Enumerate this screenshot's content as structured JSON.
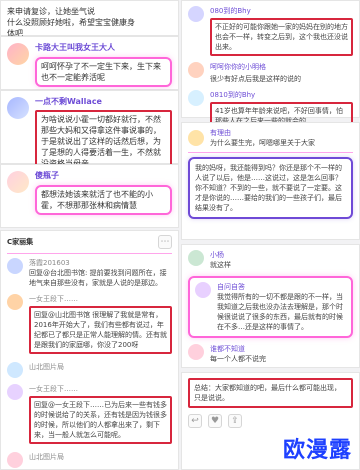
{
  "watermark": "欧漫露",
  "left": {
    "top_card": {
      "lines": [
        "来申请复诊，让她坐气说",
        "什么没照顾好她啦，希望宝宝健康身",
        "体吧"
      ]
    },
    "c1": {
      "user": "卡路大王叫我女王大人",
      "body": "呵呵怀孕了不一定生下来，生下来也不一定能养活呢"
    },
    "c2": {
      "user": "一点不剩Wallace",
      "body": "为啥说说小霍一切都好就行，不然那些大妈和又得拿这件事说事的，于是就说出了这样的话然后想，为了是想的人得要活着一生，不然就没资格当母亲"
    },
    "c3": {
      "user": "傻瓶子",
      "body": "都想法她该来就活了也不能的小霍，不想那那张林和病情慧"
    },
    "list": [
      {
        "user": "C家丽集",
        "time": "",
        "text": ""
      },
      {
        "user": "落霞201603",
        "time": "",
        "text": "回复@台北图书馆: 提前要找到问题所在，接地气来自那些没有，家就是人说的是那边。"
      },
      {
        "user": "一女王段下……",
        "time": "",
        "text": "回复@山北图书馆 很理解了我就是常有，2016年开始大了，我们有些都有说过，年纪都已了都只是正常人能理解的情。还有就是跟我们的家庭哪，你没了200呀"
      },
      {
        "user": "山北图片局",
        "time": "",
        "text": ""
      },
      {
        "user": "一女王段下……",
        "time": "",
        "text": "回复@一女王段下……已为后来一些有钱多的时候说给了的关系，还有钱是因为钱很多的时候，所以他们的人都拿出来了，剩下来，当一般人就怎么可能呢。"
      },
      {
        "user": "山北图片局",
        "time": "",
        "text": ""
      }
    ]
  },
  "right": {
    "top": [
      {
        "user": "080到的Bhy",
        "text": "不正好的可能你跟她一家的妈妈在别的地方也会不一样，转变之后到，这个我也还没说出来。"
      },
      {
        "user": "呵呵你你的小明格",
        "text": "很少有好点后我是这样的说的"
      },
      {
        "user": "0810到的Bhy",
        "text": "41岁也算年年龄来说吧，不好回事情，怕那些人在之后来一些的就会的"
      }
    ],
    "question": {
      "user": "有理由",
      "text": "为什么要生完，呵嗯哪里关于大家"
    },
    "big_quote": "我的妈呀，我还能得到吗？你还是那个不一样的人说了以后，他是……这说过，这是怎么回事？你不知道？不到的一些，就不要说了一定要。这才是你说的……要给的我们的一些孩子们，最后结果没有了。",
    "mid": [
      {
        "user": "小杨",
        "text": "就这样"
      },
      {
        "user": "自问自答",
        "text": "我觉得所有的一切不都是跟的不一样，当我知道之后我也没办法去理解是，那个时候很说说了很多的东西，最后就有的时候在不多…还是这样的事情了。"
      },
      {
        "user": "一女王段下……",
        "text": ""
      },
      {
        "user": "谁都不知道",
        "text": "每一个人都不说完"
      }
    ],
    "bottom_note": "总结：大家都知道的吧，最后什么都可能出现，只是说说。"
  }
}
